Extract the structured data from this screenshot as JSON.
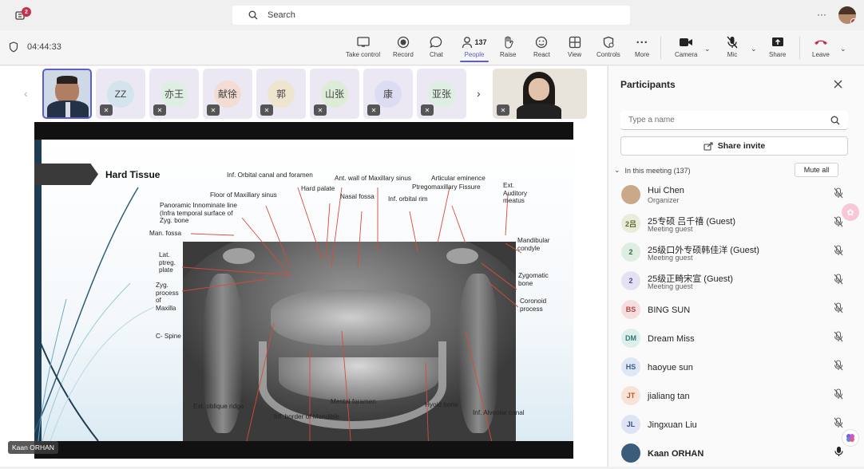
{
  "topbar": {
    "search_placeholder": "Search",
    "notification_count": "2",
    "more_label": "···"
  },
  "meeting": {
    "timer": "04:44:33",
    "toolbar": {
      "take_control": "Take control",
      "record": "Record",
      "chat": "Chat",
      "people": "People",
      "people_count": "137",
      "raise": "Raise",
      "react": "React",
      "view": "View",
      "controls": "Controls",
      "more": "More",
      "camera": "Camera",
      "mic": "Mic",
      "share": "Share",
      "leave": "Leave"
    }
  },
  "gallery": {
    "tiles": [
      {
        "initials": "ZZ",
        "color": "#d3e4ec"
      },
      {
        "initials": "亦王",
        "color": "#dfeee2"
      },
      {
        "initials": "献徐",
        "color": "#f3dcd4"
      },
      {
        "initials": "郭",
        "color": "#efe4cd"
      },
      {
        "initials": "山张",
        "color": "#dcecd6"
      },
      {
        "initials": "康",
        "color": "#dcdcf2"
      },
      {
        "initials": "亚张",
        "color": "#dfeee2"
      }
    ]
  },
  "presenter_label": "Kaan ORHAN",
  "slide": {
    "title": "Hard Tissue",
    "labels": {
      "inf_orbital_canal": "Inf. Orbital canal and foramen",
      "ant_wall": "Ant. wall of Maxillary sinus",
      "articular": "Articular eminence",
      "ext_auditory": "Ext.\nAuditory\nmeatus",
      "floor_sinus": "Floor of Maxillary sinus",
      "hard_palate": "Hard palate",
      "nasal_fossa": "Nasal fossa",
      "inf_orbital_rim": "Inf. orbital rim",
      "ptreg_fissure": "Ptregomaxillary Fissure",
      "panoramic": "Panoramic Innominate line\n(Infra temporal surface of\nZyg. bone",
      "man_fossa": "Man. fossa",
      "lat_ptreg": "Lat.\nptreg.\nplate",
      "zyg_process": "Zyg.\nprocess\nof\nMaxilla",
      "c_spine": "C- Spine",
      "mandibular_condyle": "Mandibular\ncondyle",
      "zygomatic_bone": "Zygomatic\nbone",
      "coronoid": "Coronoid\nprocess",
      "ext_oblique": "Ext. oblique ridge",
      "inf_border": "Inf. border of Mandible",
      "mental_foramen": "Mental foramen",
      "hyoid": "Hyoid bone",
      "inf_alveolar": "Inf. Alveolar canal"
    }
  },
  "participants": {
    "title": "Participants",
    "search_placeholder": "Type a name",
    "share_invite": "Share invite",
    "in_meeting": "In this meeting (137)",
    "mute_all": "Mute all",
    "people": [
      {
        "initials": "",
        "name": "Hui Chen",
        "sub": "Organizer",
        "bg": "#c9a98a",
        "fg": "#fff"
      },
      {
        "initials": "2吕",
        "name": "25专硕 吕千禧 (Guest)",
        "sub": "Meeting guest",
        "bg": "#e8ecd9",
        "fg": "#5d6b2f"
      },
      {
        "initials": "2",
        "name": "25级口外专硕韩佳洋 (Guest)",
        "sub": "Meeting guest",
        "bg": "#dfeee2",
        "fg": "#2f6b3c"
      },
      {
        "initials": "2",
        "name": "25级正畸宋宣 (Guest)",
        "sub": "Meeting guest",
        "bg": "#e4e2f2",
        "fg": "#4a4a8a"
      },
      {
        "initials": "BS",
        "name": "BING SUN",
        "sub": "",
        "bg": "#f7dede",
        "fg": "#b04646"
      },
      {
        "initials": "DM",
        "name": "Dream Miss",
        "sub": "",
        "bg": "#dcefed",
        "fg": "#2f7a70"
      },
      {
        "initials": "HS",
        "name": "haoyue sun",
        "sub": "",
        "bg": "#dde8f4",
        "fg": "#3a5f8a"
      },
      {
        "initials": "JT",
        "name": "jialiang tan",
        "sub": "",
        "bg": "#f9e2d6",
        "fg": "#b35a2a"
      },
      {
        "initials": "JL",
        "name": "Jingxuan Liu",
        "sub": "",
        "bg": "#dde4f4",
        "fg": "#3a4f8a"
      },
      {
        "initials": "",
        "name": "Kaan ORHAN",
        "sub": "",
        "bg": "#3b5c7a",
        "fg": "#fff"
      }
    ]
  }
}
